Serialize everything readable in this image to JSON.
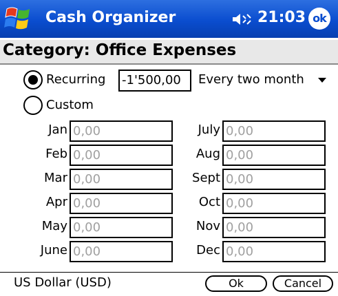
{
  "titlebar": {
    "app_title": "Cash Organizer",
    "time": "21:03",
    "ok_label": "ok"
  },
  "header": {
    "category_title": "Category: Office Expenses"
  },
  "schedule": {
    "recurring_label": "Recurring",
    "recurring_selected": true,
    "amount": "-1'500,00",
    "frequency": "Every two month",
    "custom_label": "Custom",
    "custom_selected": false
  },
  "months": [
    {
      "label": "Jan",
      "value": "0,00"
    },
    {
      "label": "Feb",
      "value": "0,00"
    },
    {
      "label": "Mar",
      "value": "0,00"
    },
    {
      "label": "Apr",
      "value": "0,00"
    },
    {
      "label": "May",
      "value": "0,00"
    },
    {
      "label": "June",
      "value": "0,00"
    },
    {
      "label": "July",
      "value": "0,00"
    },
    {
      "label": "Aug",
      "value": "0,00"
    },
    {
      "label": "Sept",
      "value": "0,00"
    },
    {
      "label": "Oct",
      "value": "0,00"
    },
    {
      "label": "Nov",
      "value": "0,00"
    },
    {
      "label": "Dec",
      "value": "0,00"
    }
  ],
  "footer": {
    "currency": "US Dollar (USD)",
    "ok_button": "Ok",
    "cancel_button": "Cancel"
  },
  "colors": {
    "titlebar_blue": "#0a4dcf",
    "disabled_text": "#a0a0a0"
  }
}
